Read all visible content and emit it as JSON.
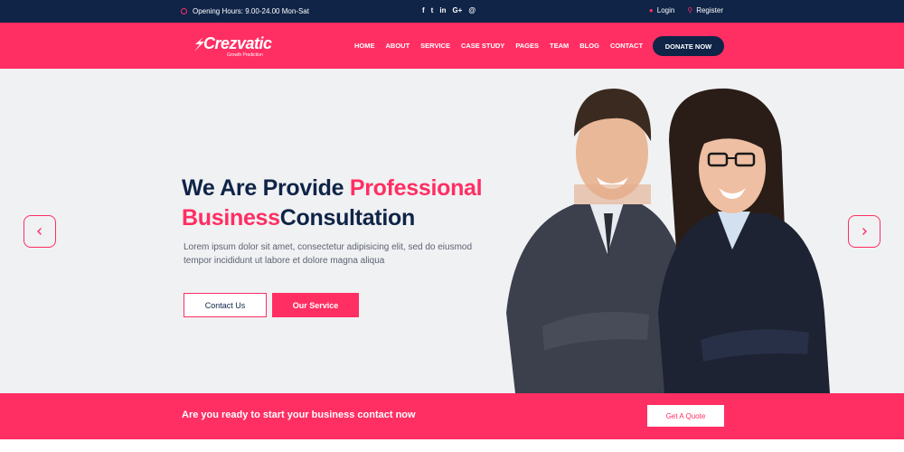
{
  "topbar": {
    "hours": "Opening Hours: 9.00-24.00 Mon-Sat",
    "socials": [
      "f",
      "t",
      "in",
      "G+",
      "@"
    ],
    "login": "Login",
    "register": "Register"
  },
  "brand": {
    "name": "Crezvatic",
    "tagline": "Growth Prediction"
  },
  "nav": {
    "items": [
      "HOME",
      "ABOUT",
      "SERVICE",
      "CASE STUDY",
      "PAGES",
      "TEAM",
      "BLOG",
      "CONTACT"
    ],
    "donate": "DONATE NOW"
  },
  "hero": {
    "title_line1_a": "We Are Provide ",
    "title_line1_b": "Professional",
    "title_line2_a": "Business",
    "title_line2_b": "Consultation",
    "description": "Lorem ipsum dolor sit amet, consectetur adipisicing elit, sed do eiusmod tempor incididunt ut labore et dolore magna aliqua",
    "contact_button": "Contact Us",
    "service_button": "Our Service"
  },
  "cta": {
    "text": "Are you ready to start your business contact now",
    "button": "Get A Quote"
  },
  "colors": {
    "primary": "#ff2e63",
    "navy": "#0f2447",
    "hero_bg": "#f0f1f3"
  }
}
